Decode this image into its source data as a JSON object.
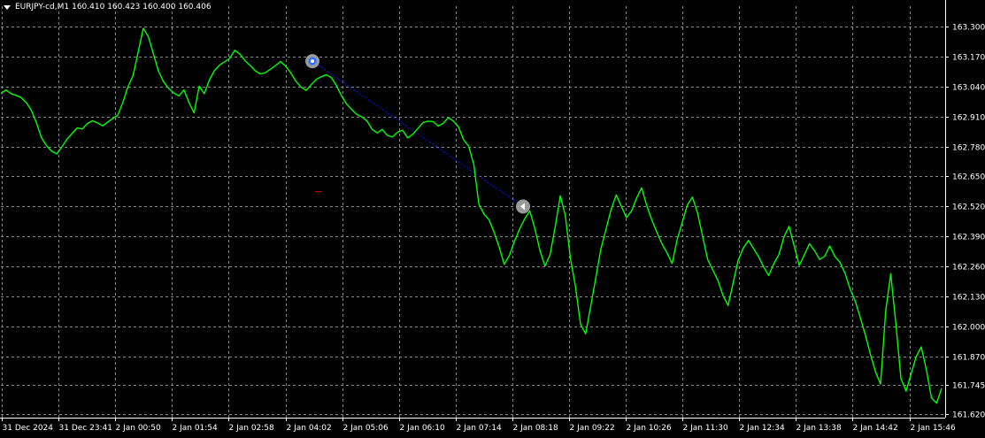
{
  "header": {
    "symbol": "EURJPY-cd,M1",
    "ohlc": "160.410 160.423 160.400 160.406"
  },
  "colors": {
    "background": "#000000",
    "grid": "#7f8a8c",
    "axis": "#ffffff",
    "price_line": "#00ff00",
    "trade_line": "#1010ff",
    "marker": "#9a9a9a",
    "marker_entry": "#2a6fff",
    "stray_mark": "#c00000"
  },
  "icons": {
    "menu_triangle": "triangle-down-icon",
    "entry_marker": "trade-entry-icon",
    "exit_marker": "trade-exit-icon"
  },
  "chart_data": {
    "type": "line",
    "title": "EURJPY-cd,M1",
    "xlabel": "",
    "ylabel": "",
    "grid": true,
    "ylim": [
      161.62,
      163.365
    ],
    "y_ticks": [
      "163.300",
      "163.170",
      "163.040",
      "162.910",
      "162.780",
      "162.650",
      "162.520",
      "162.390",
      "162.260",
      "162.130",
      "162.000",
      "161.870",
      "161.745",
      "161.620"
    ],
    "x_ticks": [
      "31 Dec 2024",
      "31 Dec 23:41",
      "2 Jan 00:50",
      "2 Jan 01:54",
      "2 Jan 02:58",
      "2 Jan 04:02",
      "2 Jan 05:06",
      "2 Jan 06:10",
      "2 Jan 07:14",
      "2 Jan 08:18",
      "2 Jan 09:22",
      "2 Jan 10:26",
      "2 Jan 11:30",
      "2 Jan 12:34",
      "2 Jan 13:38",
      "2 Jan 14:42",
      "2 Jan 15:46"
    ],
    "series": [
      {
        "values": [
          163.01,
          163.02,
          163.0,
          162.99,
          162.98,
          162.96,
          162.93,
          162.88,
          162.82,
          162.79,
          162.77,
          162.76,
          162.79,
          162.82,
          162.84,
          162.86,
          162.85,
          162.87,
          162.88,
          162.87,
          162.86,
          162.88,
          162.9,
          162.92,
          162.98,
          163.05,
          163.1,
          163.2,
          163.3,
          163.26,
          163.18,
          163.1,
          163.05,
          163.02,
          163.0,
          162.99,
          163.02,
          162.97,
          162.93,
          163.05,
          163.02,
          163.08,
          163.12,
          163.14,
          163.15,
          163.16,
          163.19,
          163.17,
          163.14,
          163.12,
          163.1,
          163.09,
          163.1,
          163.12,
          163.14,
          163.16,
          163.14,
          163.11,
          163.07,
          163.04,
          163.02,
          163.04,
          163.06,
          163.07,
          163.08,
          163.07,
          163.04,
          163.0,
          162.97,
          162.95,
          162.93,
          162.92,
          162.9,
          162.86,
          162.84,
          162.85,
          162.82,
          162.81,
          162.83,
          162.84,
          162.81,
          162.83,
          162.86,
          162.89,
          162.9,
          162.9,
          162.88,
          162.89,
          162.91,
          162.89,
          162.86,
          162.8,
          162.77,
          162.69,
          162.52,
          162.48,
          162.46,
          162.41,
          162.35,
          162.28,
          162.32,
          162.38,
          162.43,
          162.47,
          162.5,
          162.42,
          162.32,
          162.25,
          162.3,
          162.42,
          162.56,
          162.48,
          162.3,
          162.18,
          162.02,
          161.98,
          162.1,
          162.22,
          162.34,
          162.42,
          162.5,
          162.56,
          162.51,
          162.46,
          162.49,
          162.55,
          162.6,
          162.53,
          162.47,
          162.42,
          162.37,
          162.33,
          162.28,
          162.38,
          162.45,
          162.52,
          162.55,
          162.48,
          162.38,
          162.28,
          162.24,
          162.2,
          162.14,
          162.1,
          162.2,
          162.3,
          162.35,
          162.38,
          162.34,
          162.3,
          162.25,
          162.21,
          162.26,
          162.3,
          162.38,
          162.43,
          162.35,
          162.27,
          162.32,
          162.37,
          162.34,
          162.3,
          162.31,
          162.35,
          162.3,
          162.27,
          162.22,
          162.15,
          162.1,
          162.03,
          161.96,
          161.88,
          161.81,
          161.76,
          162.08,
          162.24,
          162.02,
          161.78,
          161.72,
          161.79,
          161.86,
          161.9,
          161.8,
          161.68,
          161.66,
          161.73
        ]
      }
    ],
    "trade": {
      "entry_price": 163.15,
      "exit_price": 162.52,
      "entry_time": "2 Jan 04:02",
      "exit_time": "2 Jan 08:18"
    }
  }
}
